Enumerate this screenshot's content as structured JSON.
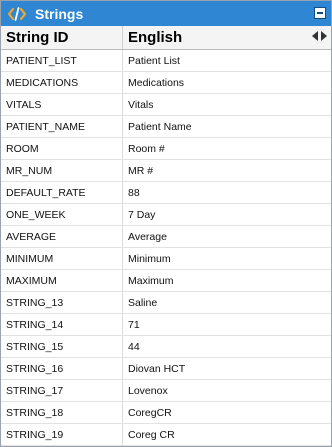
{
  "panel": {
    "title": "Strings",
    "title_icon": "code-icon",
    "accent_color": "#2f86d3"
  },
  "table": {
    "headers": [
      "String ID",
      "English"
    ],
    "rows": [
      {
        "id": "PATIENT_LIST",
        "english": "Patient List"
      },
      {
        "id": "MEDICATIONS",
        "english": "Medications"
      },
      {
        "id": "VITALS",
        "english": "Vitals"
      },
      {
        "id": "PATIENT_NAME",
        "english": "Patient Name"
      },
      {
        "id": "ROOM",
        "english": "Room #"
      },
      {
        "id": "MR_NUM",
        "english": "MR #"
      },
      {
        "id": "DEFAULT_RATE",
        "english": "88"
      },
      {
        "id": "ONE_WEEK",
        "english": "7 Day"
      },
      {
        "id": "AVERAGE",
        "english": "Average"
      },
      {
        "id": "MINIMUM",
        "english": "Minimum"
      },
      {
        "id": "MAXIMUM",
        "english": "Maximum"
      },
      {
        "id": "STRING_13",
        "english": "Saline"
      },
      {
        "id": "STRING_14",
        "english": "71"
      },
      {
        "id": "STRING_15",
        "english": "44"
      },
      {
        "id": "STRING_16",
        "english": "Diovan HCT"
      },
      {
        "id": "STRING_17",
        "english": "Lovenox"
      },
      {
        "id": "STRING_18",
        "english": "CoregCR"
      },
      {
        "id": "STRING_19",
        "english": "Coreg CR"
      }
    ]
  }
}
